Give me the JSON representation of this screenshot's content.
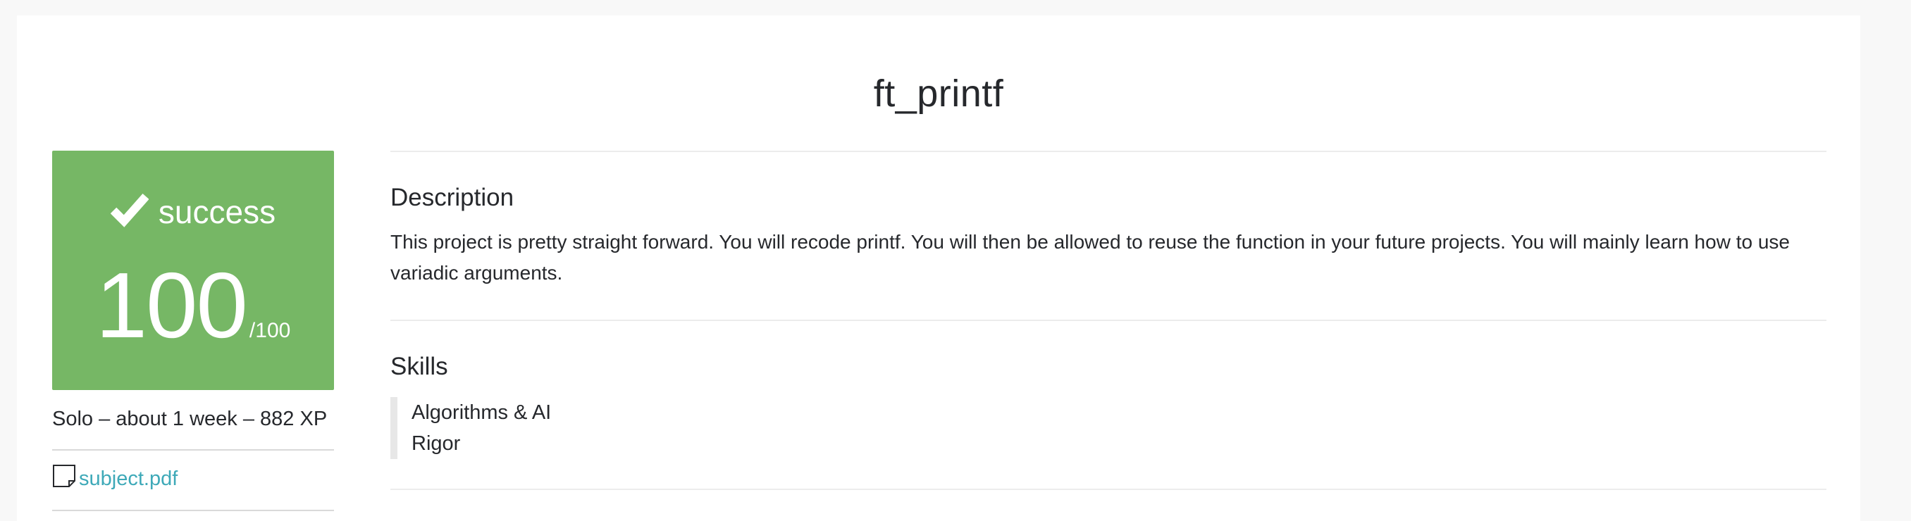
{
  "project": {
    "title": "ft_printf",
    "status": "success",
    "score": "100",
    "score_max": "/100",
    "meta": "Solo – about 1 week – 882 XP",
    "attachment": "subject.pdf",
    "status_color": "#76b765",
    "link_color": "#3ea9b8"
  },
  "description": {
    "heading": "Description",
    "text": "This project is pretty straight forward. You will recode printf. You will then be allowed to reuse the function in your future projects. You will mainly learn how to use variadic arguments."
  },
  "skills": {
    "heading": "Skills",
    "items": [
      {
        "label": "Algorithms & AI"
      },
      {
        "label": "Rigor"
      }
    ]
  },
  "icons": {
    "status": "check-icon",
    "attachment": "file-icon"
  }
}
